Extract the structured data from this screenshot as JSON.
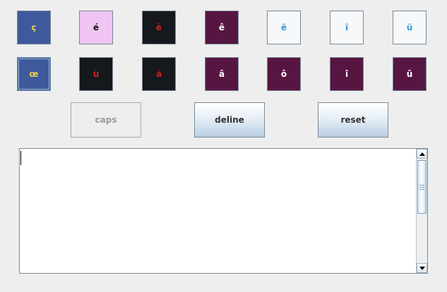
{
  "keys": {
    "row1": [
      {
        "char": "ç",
        "bg": "#3e5a9c",
        "fg": "#e6d34a"
      },
      {
        "char": "é",
        "bg": "#efc4f2",
        "fg": "#111111"
      },
      {
        "char": "è",
        "bg": "#15181c",
        "fg": "#d11f1f"
      },
      {
        "char": "ê",
        "bg": "#571642",
        "fg": "#ffffff"
      },
      {
        "char": "ë",
        "bg": "#f6f8fa",
        "fg": "#3a9bd6"
      },
      {
        "char": "ï",
        "bg": "#f6f8fa",
        "fg": "#3a9bd6"
      },
      {
        "char": "ü",
        "bg": "#f6f8fa",
        "fg": "#3a9bd6"
      }
    ],
    "row2": [
      {
        "char": "œ",
        "bg": "#3e5a9c",
        "fg": "#e6d34a"
      },
      {
        "char": "ù",
        "bg": "#15181c",
        "fg": "#d11f1f"
      },
      {
        "char": "à",
        "bg": "#15181c",
        "fg": "#d11f1f"
      },
      {
        "char": "â",
        "bg": "#571642",
        "fg": "#ffffff"
      },
      {
        "char": "ô",
        "bg": "#571642",
        "fg": "#ffffff"
      },
      {
        "char": "î",
        "bg": "#571642",
        "fg": "#ffffff"
      },
      {
        "char": "û",
        "bg": "#571642",
        "fg": "#ffffff"
      }
    ]
  },
  "buttons": {
    "caps": "caps",
    "deline": "deline",
    "reset": "reset"
  },
  "textarea": {
    "value": ""
  },
  "icons": {
    "scroll_up": "triangle-up-icon",
    "scroll_down": "triangle-down-icon",
    "thumb_grip": "grip-icon"
  }
}
